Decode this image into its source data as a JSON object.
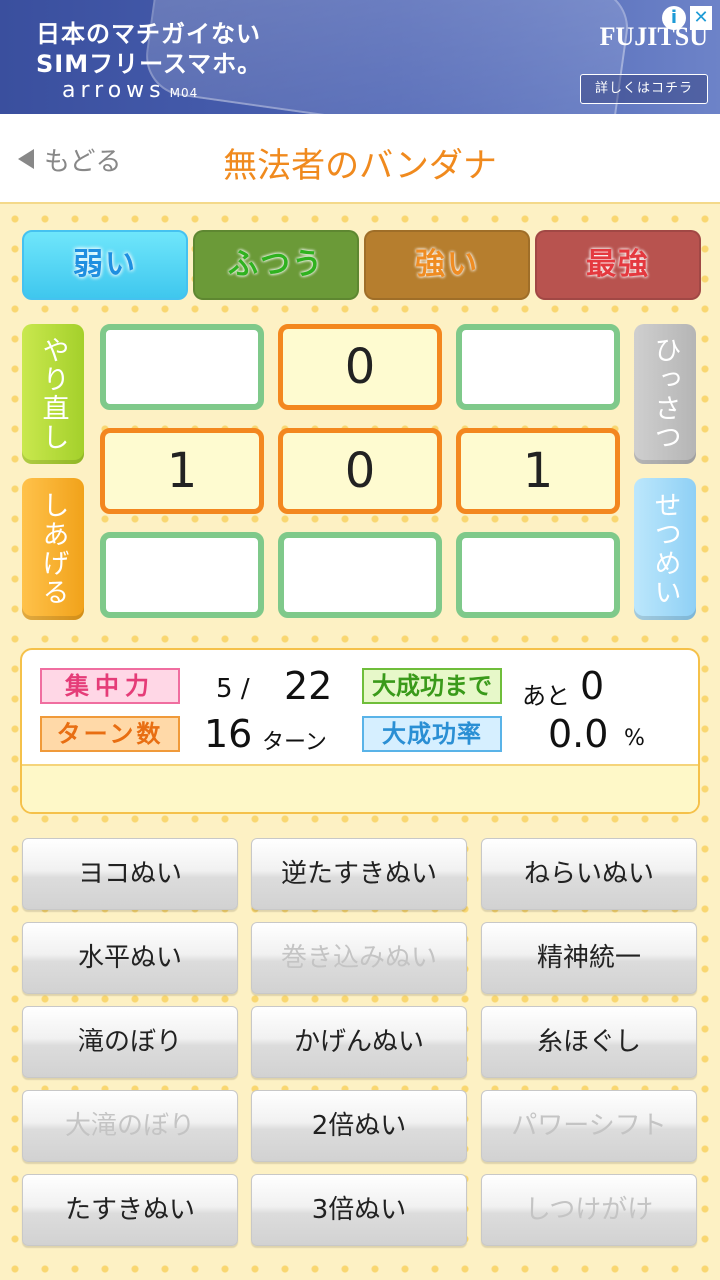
{
  "ad": {
    "line1": "日本のマチガイない",
    "line2": "SIMフリースマホ。",
    "product": "arrows",
    "model": "M04",
    "brand": "FUJITSU",
    "info_glyph": "i",
    "close_glyph": "✕",
    "cta": "詳しくはコチラ"
  },
  "header": {
    "back_label": "もどる",
    "title": "無法者のバンダナ"
  },
  "difficulty": [
    {
      "label": "弱い",
      "selected": true
    },
    {
      "label": "ふつう",
      "selected": false
    },
    {
      "label": "強い",
      "selected": false
    },
    {
      "label": "最強",
      "selected": false
    }
  ],
  "side_buttons": {
    "redo": "やり直し",
    "finish": "しあげる",
    "special": "ひっさつ",
    "explain": "せつめい"
  },
  "grid": [
    [
      "",
      "0",
      ""
    ],
    [
      "1",
      "0",
      "1"
    ],
    [
      "",
      "",
      ""
    ]
  ],
  "status": {
    "focus_label": "集中力",
    "focus_current": "5",
    "focus_sep": "/",
    "focus_max": "22",
    "turns_label": "ターン数",
    "turns_value": "16",
    "turns_unit": "ターン",
    "to_success_label": "大成功まで",
    "to_success_prefix": "あと",
    "to_success_value": "0",
    "rate_label": "大成功率",
    "rate_value": "0.0",
    "rate_unit": "%",
    "message": ""
  },
  "skills": [
    {
      "label": "ヨコぬい",
      "enabled": true
    },
    {
      "label": "逆たすきぬい",
      "enabled": true
    },
    {
      "label": "ねらいぬい",
      "enabled": true
    },
    {
      "label": "水平ぬい",
      "enabled": true
    },
    {
      "label": "巻き込みぬい",
      "enabled": false
    },
    {
      "label": "精神統一",
      "enabled": true
    },
    {
      "label": "滝のぼり",
      "enabled": true
    },
    {
      "label": "かげんぬい",
      "enabled": true
    },
    {
      "label": "糸ほぐし",
      "enabled": true
    },
    {
      "label": "大滝のぼり",
      "enabled": false
    },
    {
      "label": "2倍ぬい",
      "enabled": true
    },
    {
      "label": "パワーシフト",
      "enabled": false
    },
    {
      "label": "たすきぬい",
      "enabled": true
    },
    {
      "label": "3倍ぬい",
      "enabled": true
    },
    {
      "label": "しつけがけ",
      "enabled": false
    }
  ]
}
